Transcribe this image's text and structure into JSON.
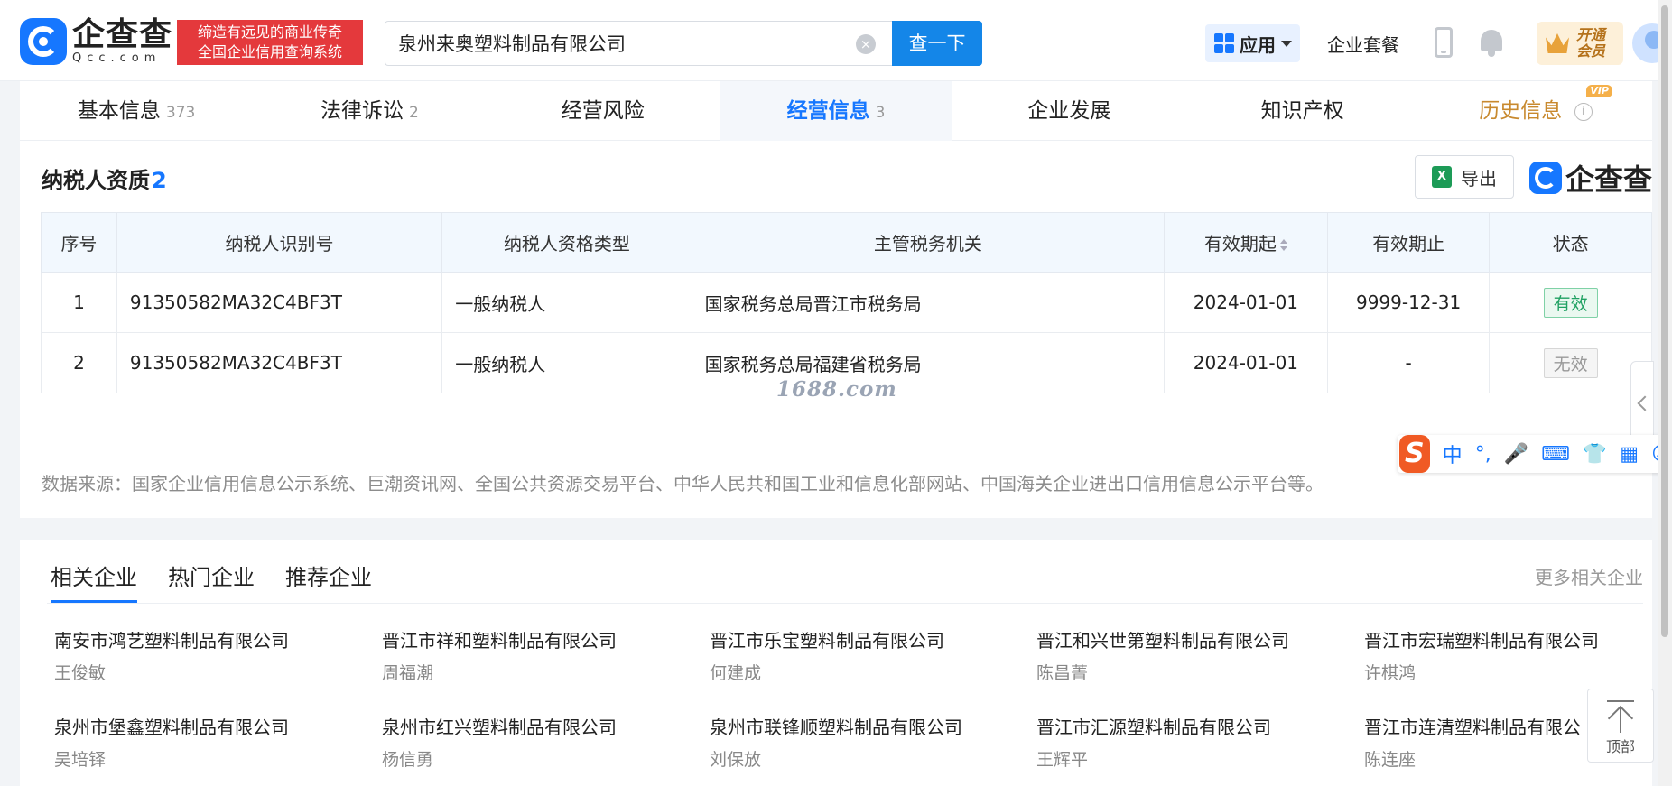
{
  "header": {
    "logo_cn": "企查查",
    "logo_en": "Qcc.com",
    "slogan_line1": "缔造有远见的商业传奇",
    "slogan_line2": "全国企业信用查询系统",
    "search_value": "泉州来奥塑料制品有限公司",
    "search_button": "查一下",
    "apps_label": "应用",
    "suite_label": "企业套餐",
    "vip_label": "开通会员"
  },
  "nav": {
    "tabs": [
      {
        "label": "基本信息",
        "count": "373"
      },
      {
        "label": "法律诉讼",
        "count": "2"
      },
      {
        "label": "经营风险",
        "count": ""
      },
      {
        "label": "经营信息",
        "count": "3"
      },
      {
        "label": "企业发展",
        "count": ""
      },
      {
        "label": "知识产权",
        "count": ""
      },
      {
        "label": "历史信息",
        "count": ""
      }
    ],
    "vip_tag": "VIP",
    "info_glyph": "i"
  },
  "section": {
    "title": "纳税人资质",
    "count": "2",
    "export_label": "导出",
    "brand": "企查查",
    "columns": [
      "序号",
      "纳税人识别号",
      "纳税人资格类型",
      "主管税务机关",
      "有效期起",
      "有效期止",
      "状态"
    ],
    "rows": [
      {
        "no": "1",
        "taxid": "91350582MA32C4BF3T",
        "type": "一般纳税人",
        "authority": "国家税务总局晋江市税务局",
        "start": "2024-01-01",
        "end": "9999-12-31",
        "status": "有效"
      },
      {
        "no": "2",
        "taxid": "91350582MA32C4BF3T",
        "type": "一般纳税人",
        "authority": "国家税务总局福建省税务局",
        "start": "2024-01-01",
        "end": "-",
        "status": "无效"
      }
    ],
    "watermark": "1688.com",
    "source": "数据来源：国家企业信用信息公示系统、巨潮资讯网、全国公共资源交易平台、中华人民共和国工业和信息化部网站、中国海关企业进出口信用信息公示平台等。"
  },
  "related": {
    "tabs": [
      "相关企业",
      "热门企业",
      "推荐企业"
    ],
    "more": "更多相关企业",
    "companies": [
      {
        "name": "南安市鸿艺塑料制品有限公司",
        "person": "王俊敏"
      },
      {
        "name": "晋江市祥和塑料制品有限公司",
        "person": "周福潮"
      },
      {
        "name": "晋江市乐宝塑料制品有限公司",
        "person": "何建成"
      },
      {
        "name": "晋江和兴世第塑料制品有限公司",
        "person": "陈昌菁"
      },
      {
        "name": "晋江市宏瑞塑料制品有限公司",
        "person": "许棋鸿"
      },
      {
        "name": "泉州市堡鑫塑料制品有限公司",
        "person": "吴培铎"
      },
      {
        "name": "泉州市红兴塑料制品有限公司",
        "person": "杨信勇"
      },
      {
        "name": "泉州市联锋顺塑料制品有限公司",
        "person": "刘保放"
      },
      {
        "name": "晋江市汇源塑料制品有限公司",
        "person": "王辉平"
      },
      {
        "name": "晋江市连清塑料制品有限公司",
        "person": "陈连座"
      }
    ]
  },
  "ime": {
    "logo": "S",
    "items": [
      "中",
      "°,",
      "🎤",
      "⌨",
      "👕",
      "▦",
      "☺"
    ]
  },
  "back_to_top": "顶部",
  "clear_glyph": "×"
}
